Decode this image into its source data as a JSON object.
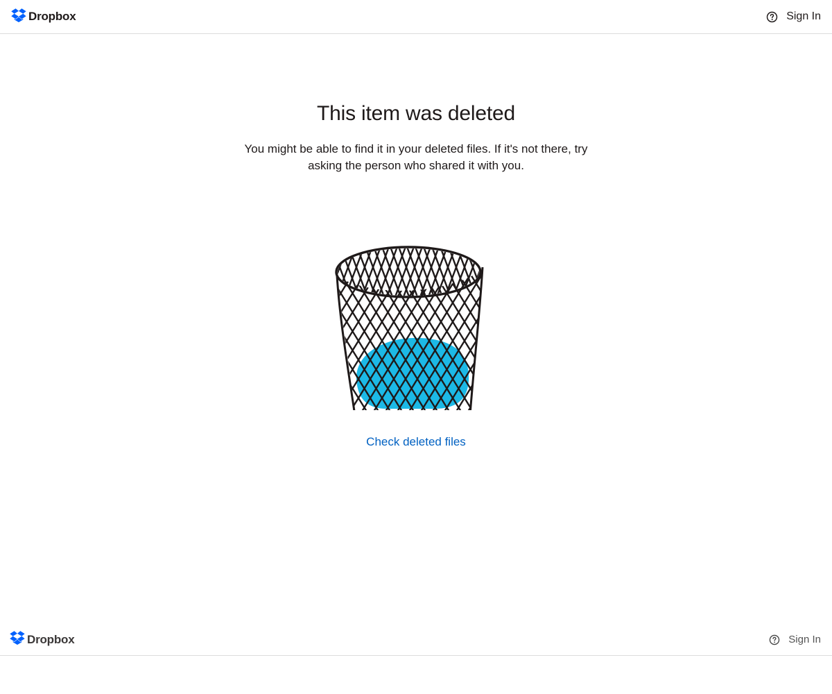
{
  "header": {
    "brand": "Dropbox",
    "help_icon": "question-circle-icon",
    "sign_in_label": "Sign In"
  },
  "main": {
    "title": "This item was deleted",
    "description": "You might be able to find it in your deleted files. If it's not there, try asking the person who shared it with you.",
    "illustration": "wastebasket-illustration",
    "cta_label": "Check deleted files"
  },
  "footer": {
    "brand": "Dropbox",
    "help_icon": "question-circle-icon",
    "sign_in_label": "Sign In"
  },
  "colors": {
    "brand_blue": "#0061fe",
    "link_blue": "#0061c2",
    "accent_cyan": "#1cb9e6",
    "text": "#1e1919",
    "divider": "#dcdcdc"
  }
}
